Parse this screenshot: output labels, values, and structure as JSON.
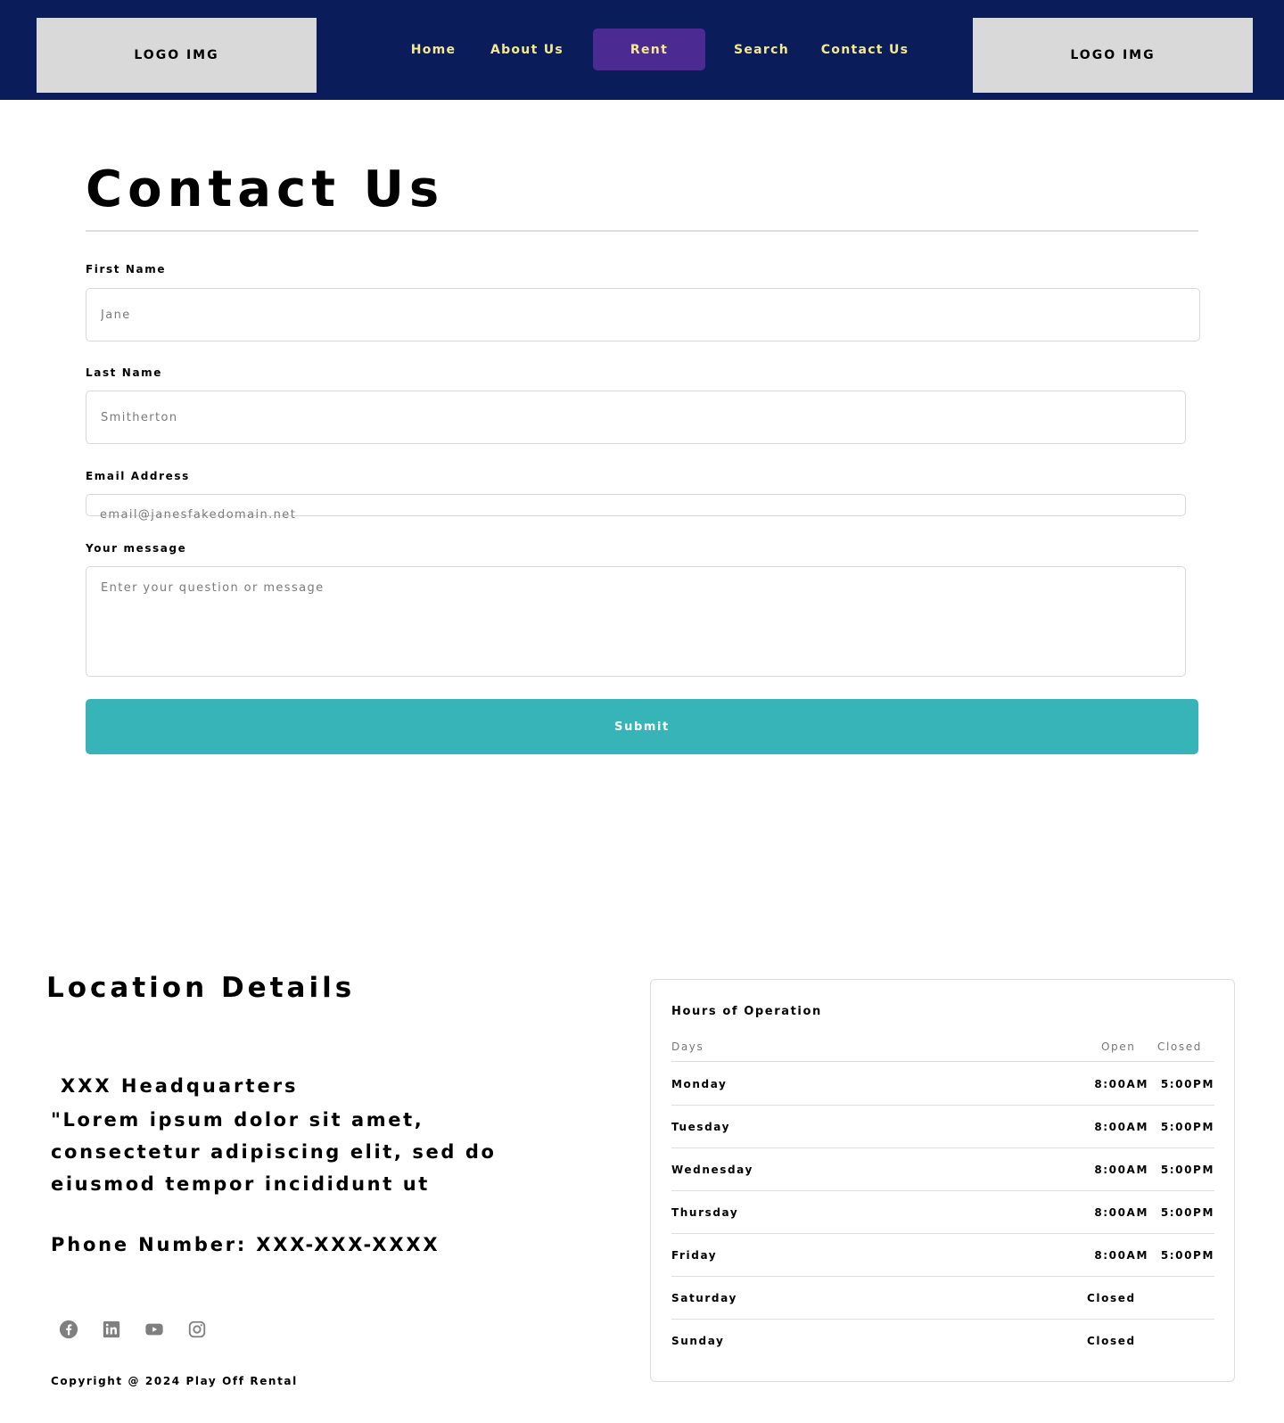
{
  "header": {
    "logo_left": "LOGO IMG",
    "logo_right": "LOGO IMG",
    "nav": {
      "home": "Home",
      "about": "About Us",
      "rent": "Rent",
      "search": "Search",
      "contact": "Contact Us"
    },
    "active_nav": "Rent",
    "colors": {
      "background": "#0b1c5a",
      "link": "#f5e98e",
      "active": "#4b2b91",
      "logo_box": "#d9d9d9"
    }
  },
  "form": {
    "title": "Contact Us",
    "first_name": {
      "label": "First Name",
      "placeholder": "Jane"
    },
    "last_name": {
      "label": "Last Name",
      "placeholder": "Smitherton"
    },
    "email": {
      "label": "Email Address",
      "placeholder": "email@janesfakedomain.net"
    },
    "message": {
      "label": "Your message",
      "placeholder": "Enter your question or message"
    },
    "submit": "Submit",
    "submit_color": "#37b4b7"
  },
  "location": {
    "title": "Location Details",
    "name": "XXX Headquarters",
    "description": "\"Lorem ipsum dolor sit amet, consectetur adipiscing elit, sed do eiusmod tempor incididunt ut",
    "phone": "Phone Number: XXX-XXX-XXXX",
    "social": [
      "facebook-icon",
      "linkedin-icon",
      "youtube-icon",
      "instagram-icon"
    ],
    "copyright": "Copyright @ 2024 Play Off Rental"
  },
  "hours": {
    "title": "Hours of Operation",
    "headers": {
      "days": "Days",
      "open": "Open",
      "closed": "Closed"
    },
    "rows": [
      {
        "day": "Monday",
        "open": "8:00AM",
        "close": "5:00PM"
      },
      {
        "day": "Tuesday",
        "open": "8:00AM",
        "close": "5:00PM"
      },
      {
        "day": "Wednesday",
        "open": "8:00AM",
        "close": "5:00PM"
      },
      {
        "day": "Thursday",
        "open": "8:00AM",
        "close": "5:00PM"
      },
      {
        "day": "Friday",
        "open": "8:00AM",
        "close": "5:00PM"
      },
      {
        "day": "Saturday",
        "status": "Closed"
      },
      {
        "day": "Sunday",
        "status": "Closed"
      }
    ]
  }
}
